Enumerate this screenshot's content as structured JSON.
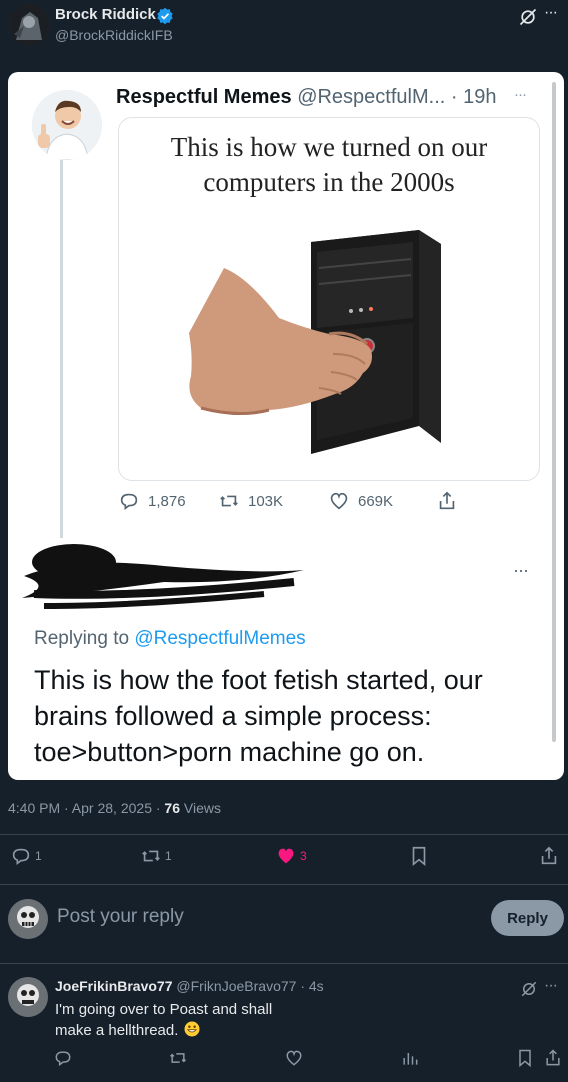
{
  "main_tweet": {
    "author_name": "Brock Riddick",
    "author_handle": "@BrockRiddickIFB"
  },
  "quoted_post": {
    "author_name": "Respectful Memes",
    "author_handle": "@RespectfulM...",
    "time": "19h",
    "image_caption_line1": "This is how we turned on our",
    "image_caption_line2": "computers in the 2000s",
    "stats": {
      "replies": "1,876",
      "reposts": "103K",
      "likes": "669K"
    }
  },
  "reply_post": {
    "replying_prefix": "Replying to ",
    "replying_handle": "@RespectfulMemes",
    "body": "This is how the foot fetish started, our brains followed a simple process: toe>button>porn machine go on."
  },
  "meta": {
    "time_date": "4:40 PM · Apr 28, 2025 · ",
    "views_count": "76",
    "views_label": " Views"
  },
  "actions": {
    "replies": "1",
    "reposts": "1",
    "likes": "3"
  },
  "compose": {
    "placeholder": "Post your reply",
    "button_label": "Reply"
  },
  "reply_tweet": {
    "author_name": "JoeFrikinBravo77",
    "author_handle": "@FriknJoeBravo77",
    "time": "· 4s",
    "body": "I'm going over to Poast and shall make a hellthread."
  },
  "colors": {
    "background": "#15202b",
    "accent": "#1d9bf0",
    "like": "#f91880"
  }
}
